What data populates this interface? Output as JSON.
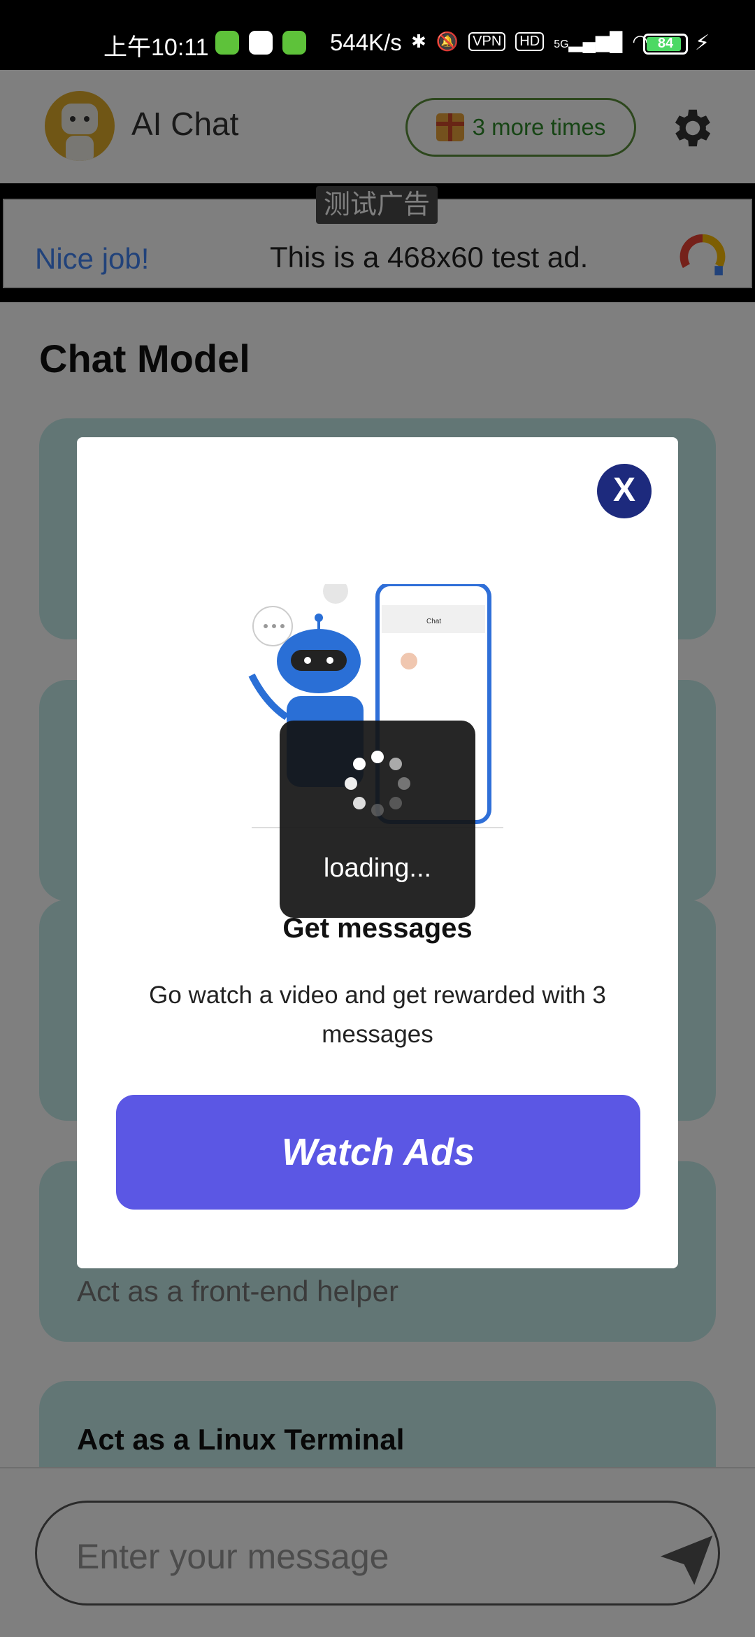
{
  "status_bar": {
    "time": "上午10:11",
    "network_speed": "544K/s",
    "vpn_label": "VPN",
    "hd_label": "HD",
    "signal_label": "5G",
    "battery": "84"
  },
  "header": {
    "title": "AI Chat",
    "more_times_label": "3 more times"
  },
  "ad": {
    "tag": "测试广告",
    "headline": "Nice job!",
    "text": "This is a 468x60 test ad."
  },
  "main": {
    "section_title": "Chat Model",
    "cards": [
      {
        "title": "",
        "description": ""
      },
      {
        "title": "",
        "description": ""
      },
      {
        "title": "",
        "description": ""
      },
      {
        "title": "",
        "description": "Act as a front-end helper"
      },
      {
        "title": "Act as a Linux Terminal",
        "description": ""
      }
    ]
  },
  "input": {
    "placeholder": "Enter your message"
  },
  "dialog": {
    "illustration_phone_title": "Chat",
    "title": "Get messages",
    "description": "Go watch a video and get rewarded with 3 messages",
    "button_label": "Watch Ads",
    "close_label": "X"
  },
  "loading": {
    "text": "loading..."
  },
  "colors": {
    "accent": "#5b57e4",
    "close_button": "#1d2a7d",
    "card_bg": "#c4ecea",
    "more_times_border": "#5a8f3a"
  }
}
